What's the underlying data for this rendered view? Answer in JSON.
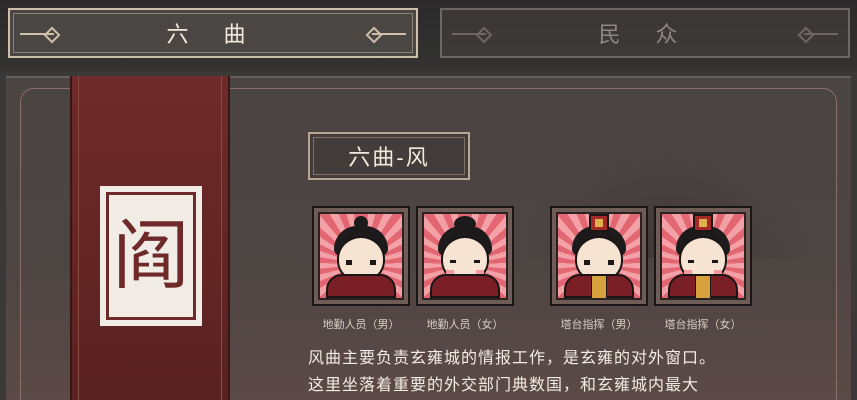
{
  "tabs": [
    {
      "label": "六 曲",
      "active": true
    },
    {
      "label": "民 众",
      "active": false
    }
  ],
  "banner": {
    "seal_glyph": "阎"
  },
  "section": {
    "title": "六曲-风"
  },
  "roles": [
    {
      "caption": "地勤人员（男）",
      "hat": "topknot",
      "gold_trim": false
    },
    {
      "caption": "地勤人员（女）",
      "hat": "bun",
      "gold_trim": false
    },
    {
      "caption": "塔台指挥（男）",
      "hat": "crown",
      "gold_trim": true
    },
    {
      "caption": "塔台指挥（女）",
      "hat": "crown",
      "gold_trim": true
    }
  ],
  "description": {
    "line1": "风曲主要负责玄雍城的情报工作，是玄雍的对外窗口。",
    "line2": "这里坐落着重要的外交部门典数国，和玄雍城内最大"
  },
  "colors": {
    "banner": "#6e2a28",
    "panel": "#4a4443",
    "tab_border": "#cdbfa8",
    "card_rays": "#e26772"
  }
}
